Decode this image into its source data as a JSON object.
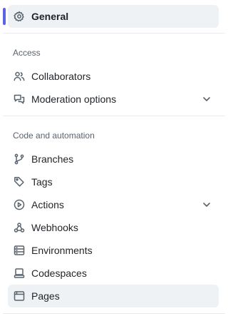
{
  "sidebar": {
    "general": {
      "label": "General",
      "icon": "gear-icon"
    },
    "access": {
      "heading": "Access",
      "items": [
        {
          "label": "Collaborators",
          "icon": "people-icon"
        },
        {
          "label": "Moderation options",
          "icon": "comment-discussion-icon",
          "expandable": true
        }
      ]
    },
    "code_automation": {
      "heading": "Code and automation",
      "items": [
        {
          "label": "Branches",
          "icon": "git-branch-icon"
        },
        {
          "label": "Tags",
          "icon": "tag-icon"
        },
        {
          "label": "Actions",
          "icon": "play-icon",
          "expandable": true
        },
        {
          "label": "Webhooks",
          "icon": "webhook-icon"
        },
        {
          "label": "Environments",
          "icon": "server-icon"
        },
        {
          "label": "Codespaces",
          "icon": "codespaces-icon"
        },
        {
          "label": "Pages",
          "icon": "browser-icon"
        }
      ]
    }
  },
  "colors": {
    "selected_marker": "#5a63e8",
    "selected_background": "#eff2f5",
    "icon": "#59636e",
    "text": "#1f2328",
    "muted_text": "#59636e",
    "divider": "#e7eaee"
  }
}
